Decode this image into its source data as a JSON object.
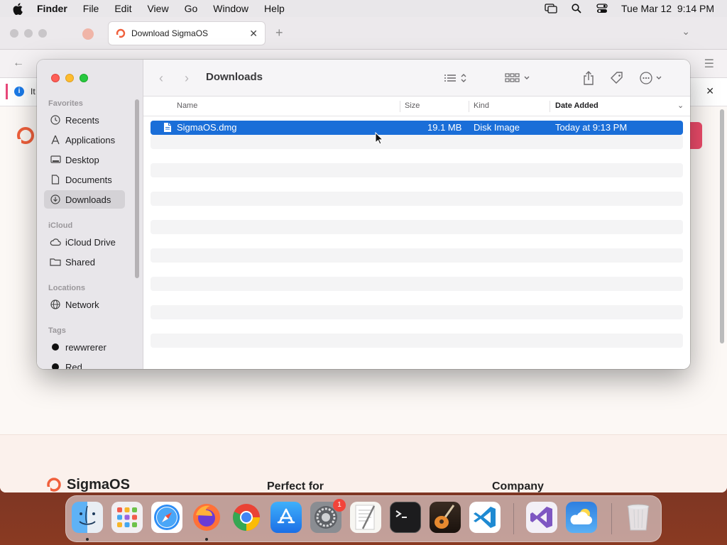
{
  "menubar": {
    "app_name": "Finder",
    "items": [
      "File",
      "Edit",
      "View",
      "Go",
      "Window",
      "Help"
    ],
    "datetime": "Tue Mar 12  9:14 PM"
  },
  "browser": {
    "tab_title": "Download SigmaOS",
    "notification_text": "It",
    "footer": {
      "brand": "SigmaOS",
      "col1_title": "Perfect for",
      "col2_title": "Company"
    },
    "colors": {
      "accent": "#ec4b6a"
    }
  },
  "finder": {
    "title": "Downloads",
    "sidebar": {
      "favorites_label": "Favorites",
      "favorites": [
        {
          "label": "Recents",
          "icon": "clock-icon"
        },
        {
          "label": "Applications",
          "icon": "applications-icon"
        },
        {
          "label": "Desktop",
          "icon": "desktop-icon"
        },
        {
          "label": "Documents",
          "icon": "document-icon"
        },
        {
          "label": "Downloads",
          "icon": "download-icon",
          "active": true
        }
      ],
      "icloud_label": "iCloud",
      "icloud": [
        {
          "label": "iCloud Drive",
          "icon": "cloud-icon"
        },
        {
          "label": "Shared",
          "icon": "shared-folder-icon"
        }
      ],
      "locations_label": "Locations",
      "locations": [
        {
          "label": "Network",
          "icon": "globe-icon"
        }
      ],
      "tags_label": "Tags",
      "tags": [
        {
          "label": "rewwrerer",
          "color": "#111111"
        },
        {
          "label": "Red",
          "color": "#111111"
        }
      ]
    },
    "columns": {
      "name": "Name",
      "size": "Size",
      "kind": "Kind",
      "date_added": "Date Added"
    },
    "files": [
      {
        "name": "SigmaOS.dmg",
        "size": "19.1 MB",
        "kind": "Disk Image",
        "date_added": "Today at 9:13 PM",
        "selected": true
      }
    ],
    "colors": {
      "selection": "#1a6ed8"
    }
  },
  "dock": {
    "apps": [
      {
        "name": "Finder",
        "icon": "finder-icon",
        "running": true
      },
      {
        "name": "Launchpad",
        "icon": "launchpad-icon"
      },
      {
        "name": "Safari",
        "icon": "safari-icon"
      },
      {
        "name": "Firefox",
        "icon": "firefox-icon",
        "running": true
      },
      {
        "name": "Chrome",
        "icon": "chrome-icon"
      },
      {
        "name": "App Store",
        "icon": "app-store-icon"
      },
      {
        "name": "System Settings",
        "icon": "settings-icon",
        "badge": "1"
      },
      {
        "name": "TextEdit",
        "icon": "textedit-icon"
      },
      {
        "name": "Terminal",
        "icon": "terminal-icon"
      },
      {
        "name": "GarageBand",
        "icon": "garageband-icon"
      },
      {
        "name": "VS Code",
        "icon": "vscode-icon"
      },
      {
        "name": "Visual Studio",
        "icon": "visual-studio-icon"
      },
      {
        "name": "Weather",
        "icon": "weather-icon"
      },
      {
        "name": "Trash",
        "icon": "trash-icon"
      }
    ]
  }
}
